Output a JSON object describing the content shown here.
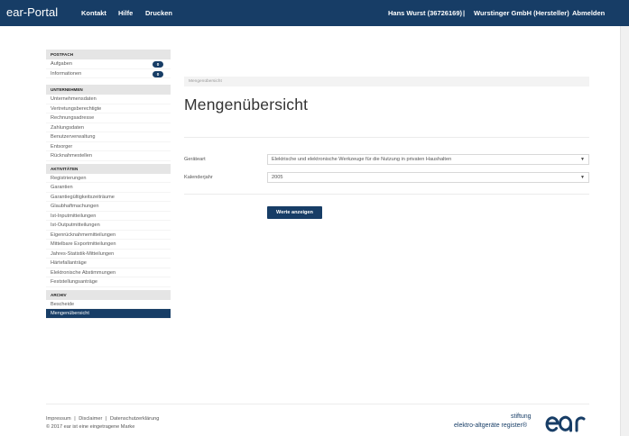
{
  "header": {
    "brand": "ear-Portal",
    "nav": [
      "Kontakt",
      "Hilfe",
      "Drucken"
    ],
    "user": "Hans Wurst (36726169)",
    "separator": "|",
    "company": "Wurstinger GmbH (Hersteller)",
    "logout": "Abmelden"
  },
  "sidebar": {
    "postfach": {
      "heading": "POSTFACH",
      "items": [
        {
          "label": "Aufgaben",
          "badge": "0"
        },
        {
          "label": "Informationen",
          "badge": "0"
        }
      ]
    },
    "unternehmen": {
      "heading": "UNTERNEHMEN",
      "items": [
        "Unternehmensdaten",
        "Vertretungsberechtigte",
        "Rechnungsadresse",
        "Zahlungsdaten",
        "Benutzerverwaltung",
        "Entsorger",
        "Rücknahmestellen"
      ]
    },
    "aktivitaeten": {
      "heading": "AKTIVITÄTEN",
      "items": [
        "Registrierungen",
        "Garantien",
        "Garantiegültigkeitszeiträume",
        "Glaubhaftmachungen",
        "Ist-Inputmitteilungen",
        "Ist-Outputmitteilungen",
        "Eigenrücknahmemitteilungen",
        "Mittelbare Exportmitteilungen",
        "Jahres-Statistik-Mitteilungen",
        "Härtefallanträge",
        "Elektronische Abstimmungen",
        "Feststellungsanträge"
      ]
    },
    "archiv": {
      "heading": "ARCHIV",
      "items": [
        "Bescheide",
        "Mengenübersicht"
      ]
    }
  },
  "main": {
    "breadcrumb": "Mengenübersicht",
    "title": "Mengenübersicht",
    "geraeteart_label": "Geräteart",
    "geraeteart_value": "Elektrische und elektronische Werkzeuge für die Nutzung in privaten Haushalten",
    "kalenderjahr_label": "Kalenderjahr",
    "kalenderjahr_value": "2005",
    "submit": "Werte anzeigen",
    "caret": "▼"
  },
  "footer": {
    "links": [
      "Impressum",
      "Disclaimer",
      "Datenschutzerklärung"
    ],
    "link_separator": "|",
    "copyright": "© 2017 ear ist eine eingetragene Marke",
    "logo_line1": "stiftung",
    "logo_line2": "elektro-altgeräte register®",
    "logo_mark": "ear"
  },
  "colors": {
    "primary": "#173d66",
    "sidebar_heading_bg": "#e5e5e5",
    "breadcrumb_bg": "#f3f3f3"
  }
}
